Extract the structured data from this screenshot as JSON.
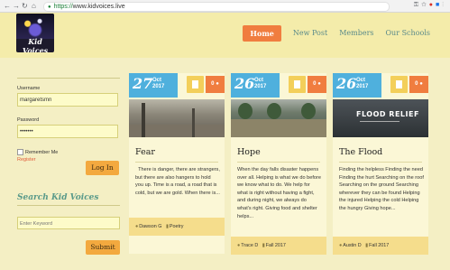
{
  "browser": {
    "url_scheme": "https://",
    "url_host": "www.kidvoices.live",
    "back_icon": "back-arrow-icon",
    "forward_icon": "forward-arrow-icon",
    "reload_icon": "reload-icon",
    "home_icon": "home-icon"
  },
  "site": {
    "logo_text": "Kid Voices",
    "menu": [
      {
        "label": "Home",
        "active": true
      },
      {
        "label": "New Post"
      },
      {
        "label": "Members"
      },
      {
        "label": "Our Schools"
      }
    ],
    "accent_color": "#f07d3f",
    "date_color": "#4fb0dd"
  },
  "sidebar": {
    "username_label": "Username",
    "username_value": "margaretsmn",
    "password_label": "Password",
    "password_value": "•••••••",
    "remember_label": "Remember Me",
    "register_label": "Register",
    "login_label": "Log In",
    "search_title": "Search Kid Voices",
    "search_placeholder": "Enter Keyword",
    "submit_label": "Submit"
  },
  "posts": [
    {
      "day": "27",
      "month": "Oct",
      "year": "2017",
      "comments": "0",
      "title": "Fear",
      "excerpt": "There is danger, there are strangers, but there are also hangers to hold you up.  Time is a road, a road that is cold, but we are gold.  When there is...",
      "author": "Dawson G",
      "category": "Poetry"
    },
    {
      "day": "26",
      "month": "Oct",
      "year": "2017",
      "comments": "0",
      "title": "Hope",
      "excerpt": "When the day falls disaster happens over all. Helping is what we do before we know what to do. We help for what is right without having a fight, and during night, we always do what's right. Giving food and shelter helps...",
      "author": "Trace D",
      "category": "Fall 2017"
    },
    {
      "day": "26",
      "month": "Oct",
      "year": "2017",
      "comments": "0",
      "title": "The Flood",
      "image_caption": "FLOOD RELIEF",
      "excerpt": "Finding the helpless Finding the need Finding the hurt Searching on the roof Searching on the ground Searching wherever they can be found Helping the injured Helping the cold Helping the hungry Giving hope...",
      "author": "Austin D",
      "category": "Fall 2017"
    }
  ]
}
